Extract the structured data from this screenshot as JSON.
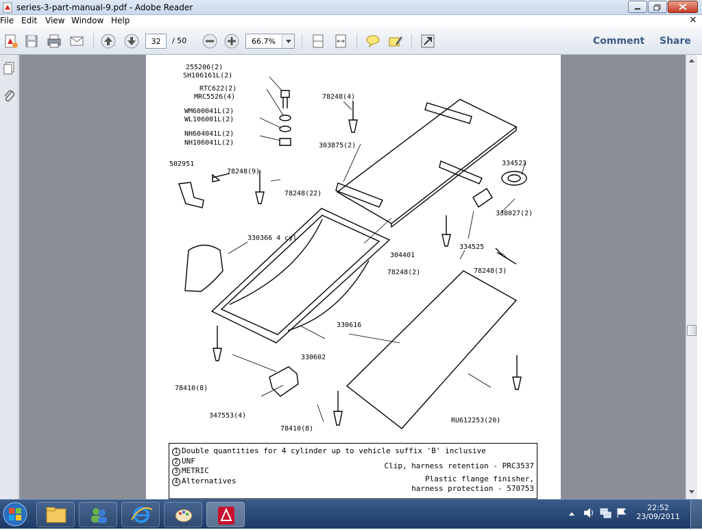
{
  "window": {
    "title": "series-3-part-manual-9.pdf - Adobe Reader"
  },
  "menu": {
    "file": "File",
    "edit": "Edit",
    "view": "View",
    "window": "Window",
    "help": "Help",
    "close": "×"
  },
  "toolbar": {
    "page_current": "32",
    "page_total": "/ 50",
    "zoom": "66.7%",
    "comment": "Comment",
    "share": "Share"
  },
  "diagram": {
    "labels": [
      "255206(2)",
      "SH106161L(2)",
      "RTC622(2)",
      "MRC5526(4)",
      "WM600041L(2)",
      "WL106001L(2)",
      "NH604041L(2)",
      "NH106041L(2)",
      "78248(4)",
      "303875(2)",
      "334523",
      "338027(2)",
      "502951",
      "78248(9)",
      "78248(22)",
      "330366 4 cyl",
      "304401",
      "334525",
      "78248(2)",
      "78248(3)",
      "330616",
      "330602",
      "78410(8)",
      "347553(4)",
      "78410(8)",
      "RU612253(20)"
    ]
  },
  "notes": {
    "n1": "Double quantities for 4 cylinder up to vehicle suffix 'B' inclusive",
    "n2": "UNF",
    "n3": "METRIC",
    "n4": "Alternatives",
    "r1": "Clip, harness retention - PRC3537",
    "r2": "Plastic flange finisher,",
    "r3": "harness protection - 570753",
    "c1": "1",
    "c2": "2",
    "c3": "3",
    "c4": "4"
  },
  "clock": {
    "time": "22:52",
    "date": "23/09/2011"
  }
}
